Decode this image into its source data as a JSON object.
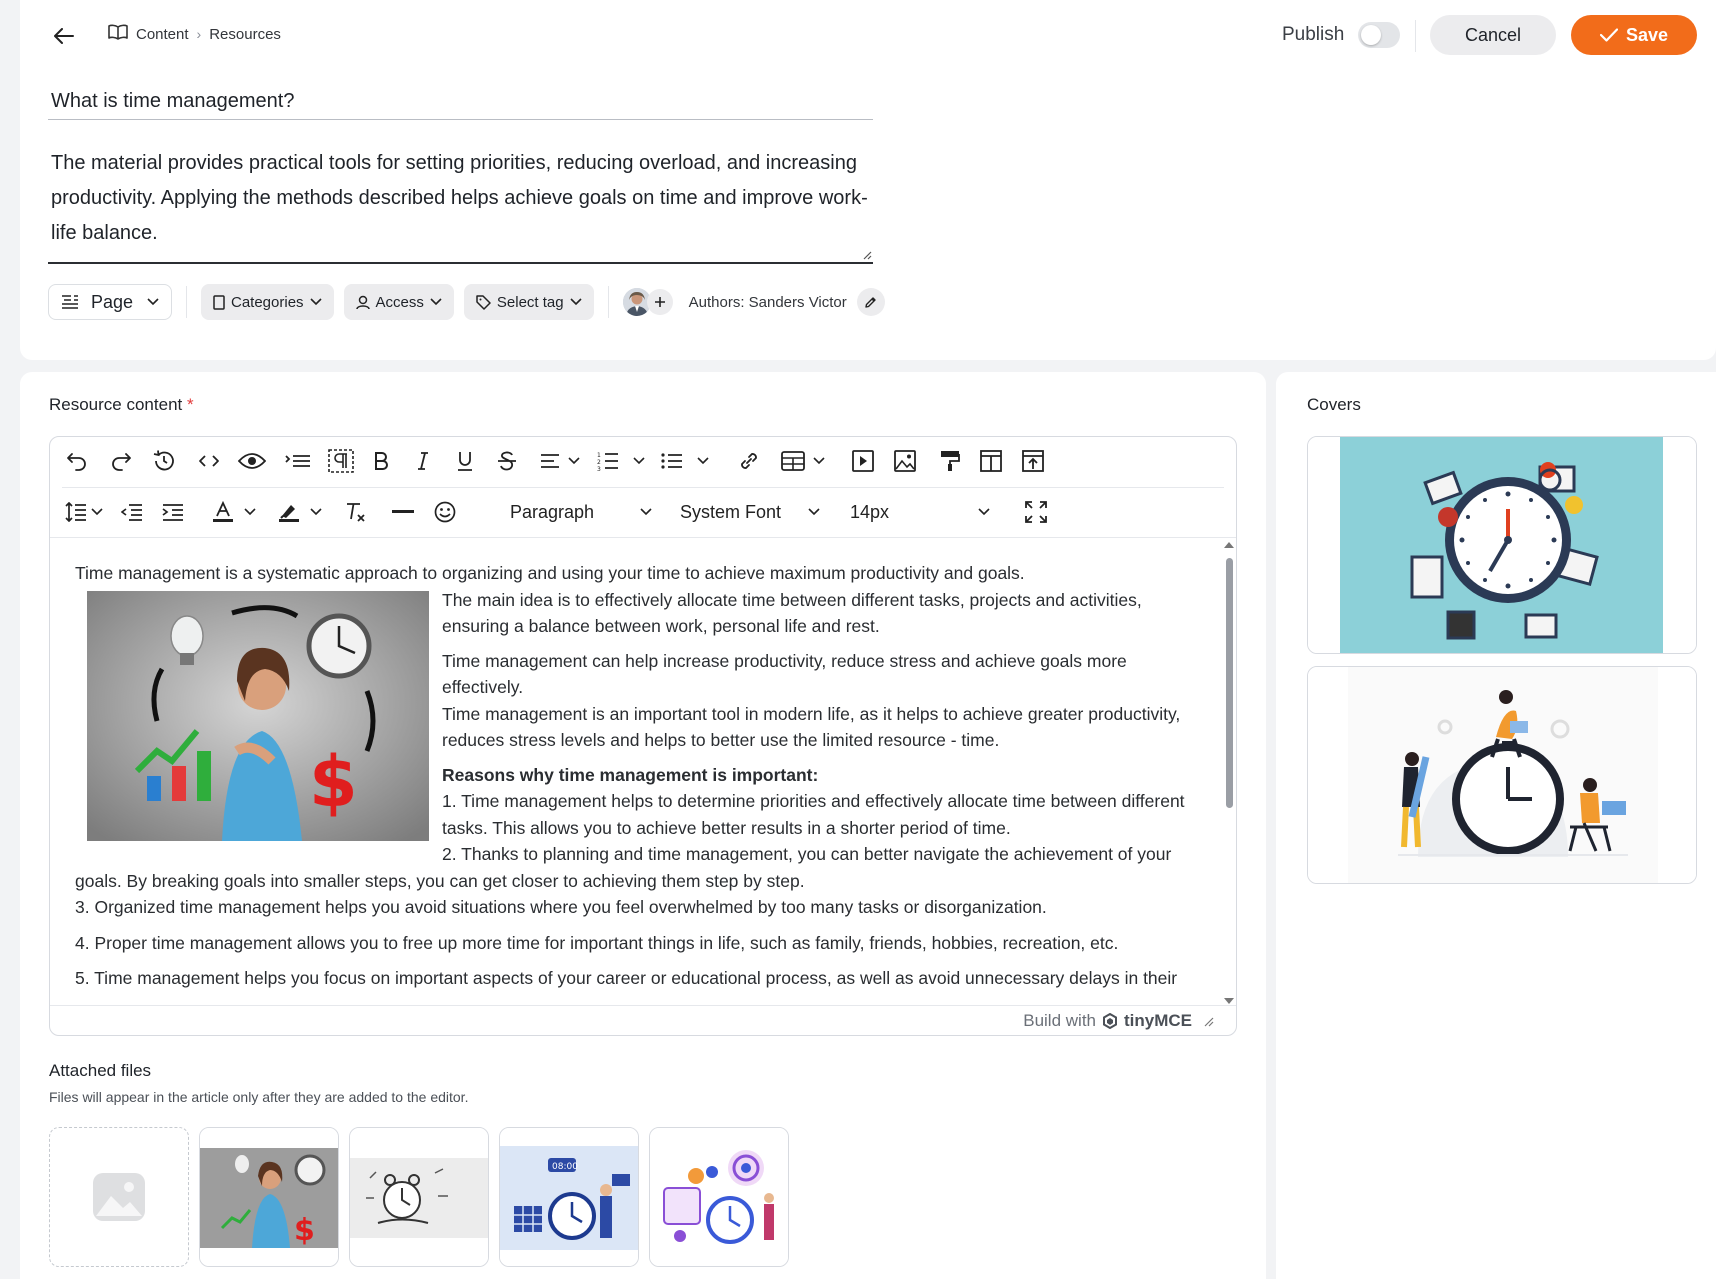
{
  "breadcrumb": {
    "items": [
      "Content",
      "Resources"
    ]
  },
  "header": {
    "publish_label": "Publish",
    "publish_on": false,
    "cancel_label": "Cancel",
    "save_label": "Save"
  },
  "resource": {
    "title": "What is time management?",
    "description": "The material provides practical tools for setting priorities, reducing overload, and increasing productivity. Applying the methods described helps achieve goals on time and improve work-life balance."
  },
  "meta": {
    "page_label": "Page",
    "categories_label": "Categories",
    "access_label": "Access",
    "tag_label": "Select tag",
    "authors_label": "Authors: Sanders Victor"
  },
  "editor": {
    "section_label": "Resource content",
    "required_mark": "*",
    "block_format": "Paragraph",
    "font_family": "System Font",
    "font_size": "14px",
    "branding_prefix": "Build with",
    "branding_name": "tinyMCE",
    "content": {
      "line1": "Time management is a systematic approach to organizing and using your time to achieve maximum productivity and goals.",
      "line2": "The main idea is to effectively allocate time between different tasks, projects and activities, ensuring a balance between work, personal life and rest.",
      "para2": "Time management can help increase productivity, reduce stress and achieve goals more effectively.",
      "para3": "Time management is an important tool in modern life, as it helps to achieve greater productivity, reduces stress levels and helps to better use the limited resource - time.",
      "heading": "Reasons why time management is important:",
      "item1": "1. Time management helps to determine priorities and effectively allocate time between different tasks. This allows you to achieve better results in a shorter period of time.",
      "item2": "2. Thanks to planning and time management, you can better navigate the achievement of your goals. By breaking goals into smaller steps, you can get closer to achieving them step by step.",
      "item3": "3. Organized time management helps you avoid situations where you feel overwhelmed by too many tasks or disorganization.",
      "item4": "4. Proper time management allows you to free up more time for important things in life, such as family, friends, hobbies, recreation, etc.",
      "item5": "5. Time management helps you focus on important aspects of your career or educational process, as well as avoid unnecessary delays in their"
    }
  },
  "attachments": {
    "title": "Attached files",
    "hint": "Files will appear in the article only after they are added to the editor."
  },
  "covers": {
    "title": "Covers"
  },
  "colors": {
    "accent": "#f26c1a",
    "required": "#e23b3b"
  }
}
